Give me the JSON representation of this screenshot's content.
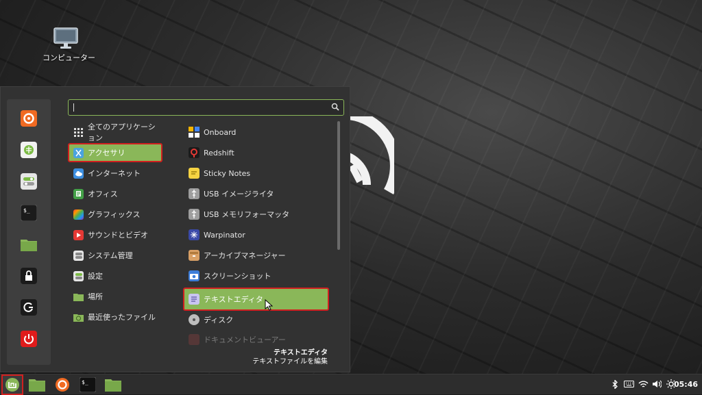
{
  "desktop": {
    "computer_label": "コンピューター"
  },
  "search": {
    "placeholder": "",
    "value": ""
  },
  "categories": [
    {
      "label": "全てのアプリケーション",
      "icon": "grid-icon"
    },
    {
      "label": "アクセサリ",
      "icon": "accessories-icon",
      "selected": true
    },
    {
      "label": "インターネット",
      "icon": "cloud-icon"
    },
    {
      "label": "オフィス",
      "icon": "office-icon"
    },
    {
      "label": "グラフィックス",
      "icon": "graphics-icon"
    },
    {
      "label": "サウンドとビデオ",
      "icon": "play-icon"
    },
    {
      "label": "システム管理",
      "icon": "system-icon"
    },
    {
      "label": "設定",
      "icon": "settings-icon"
    },
    {
      "label": "場所",
      "icon": "folder-icon"
    },
    {
      "label": "最近使ったファイル",
      "icon": "recent-folder-icon"
    }
  ],
  "apps": [
    {
      "label": "Onboard",
      "icon": "onboard-icon"
    },
    {
      "label": "Redshift",
      "icon": "redshift-icon"
    },
    {
      "label": "Sticky Notes",
      "icon": "sticky-notes-icon"
    },
    {
      "label": "USB イメージライタ",
      "icon": "usb-icon"
    },
    {
      "label": "USB メモリフォーマッタ",
      "icon": "usb-icon"
    },
    {
      "label": "Warpinator",
      "icon": "warpinator-icon"
    },
    {
      "label": "アーカイブマネージャー",
      "icon": "archive-icon"
    },
    {
      "label": "スクリーンショット",
      "icon": "camera-icon"
    },
    {
      "label": "テキストエディタ",
      "icon": "text-editor-icon",
      "selected": true
    },
    {
      "label": "ディスク",
      "icon": "disk-icon"
    },
    {
      "label": "ドキュメントビューアー",
      "icon": "document-viewer-icon",
      "dim": true
    }
  ],
  "description": {
    "title": "テキストエディタ",
    "subtitle": "テキストファイルを編集"
  },
  "taskbar": {
    "clock": "05:46"
  },
  "colors": {
    "accent": "#8ab759",
    "highlight_border": "#d21f1f"
  }
}
